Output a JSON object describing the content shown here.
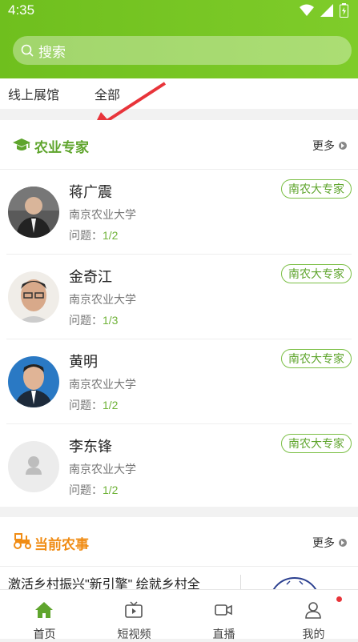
{
  "status": {
    "time": "4:35"
  },
  "search": {
    "placeholder": "搜索"
  },
  "tabs": [
    "线上展馆",
    "全部"
  ],
  "experts_section": {
    "title": "农业专家",
    "more": "更多",
    "experts": [
      {
        "name": "蒋广震",
        "org": "南京农业大学",
        "q_label": "问题：",
        "q_value": "1/2",
        "tag": "南农大专家",
        "avatar": "photo-man-suit"
      },
      {
        "name": "金奇江",
        "org": "南京农业大学",
        "q_label": "问题：",
        "q_value": "1/3",
        "tag": "南农大专家",
        "avatar": "photo-man-glasses"
      },
      {
        "name": "黄明",
        "org": "南京农业大学",
        "q_label": "问题：",
        "q_value": "1/2",
        "tag": "南农大专家",
        "avatar": "photo-man-blue"
      },
      {
        "name": "李东锋",
        "org": "南京农业大学",
        "q_label": "问题：",
        "q_value": "1/2",
        "tag": "南农大专家",
        "avatar": "placeholder-person"
      }
    ]
  },
  "farming_section": {
    "title": "当前农事",
    "more": "更多"
  },
  "news": {
    "headline": "激活乡村振兴\"新引擎\" 绘就乡村全"
  },
  "tabbar": [
    {
      "label": "首页",
      "icon": "home-icon",
      "active": true
    },
    {
      "label": "短视频",
      "icon": "tv-icon",
      "active": false
    },
    {
      "label": "直播",
      "icon": "video-camera-icon",
      "active": false
    },
    {
      "label": "我的",
      "icon": "user-icon",
      "active": false
    }
  ],
  "colors": {
    "brand_green": "#7cc82a",
    "expert_title": "#5fa52d",
    "farming_title": "#f08c14",
    "arrow": "#e8343a"
  }
}
